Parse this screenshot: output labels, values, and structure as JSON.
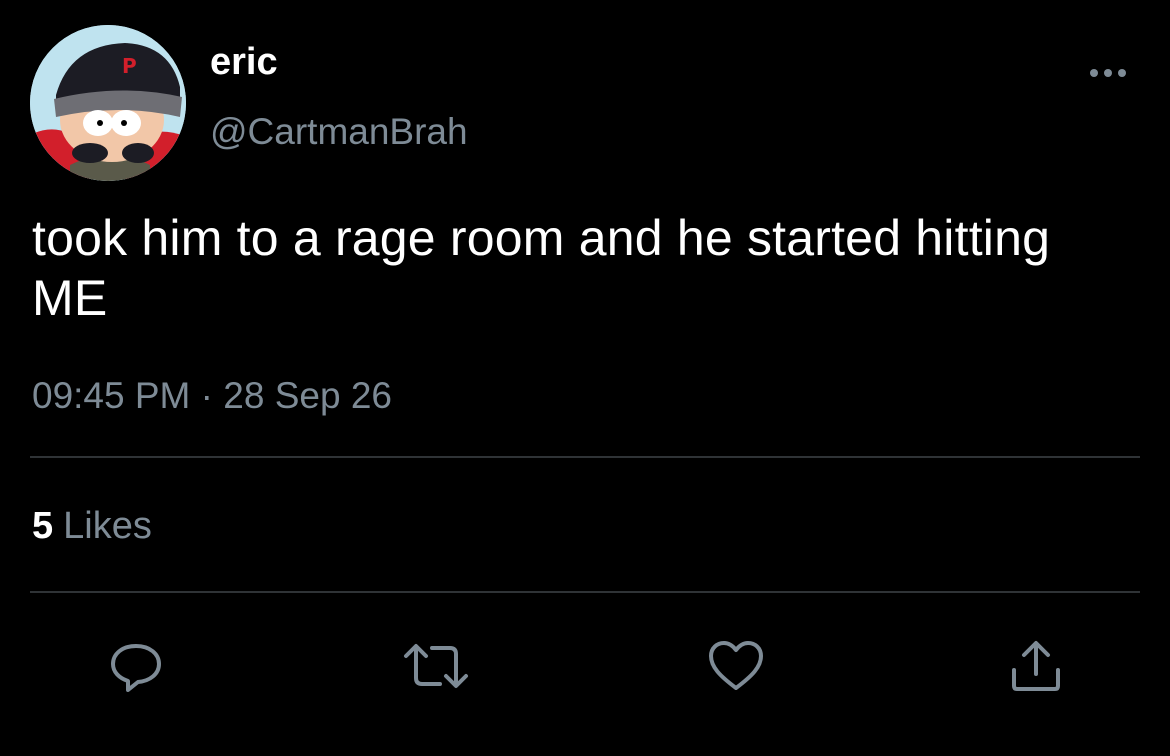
{
  "user": {
    "display_name": "eric",
    "handle": "@CartmanBrah",
    "avatar_icon": "cartman-avatar"
  },
  "tweet": {
    "text": "took him to a rage room and he started hitting ME",
    "time": "09:45 PM",
    "separator": "·",
    "date": "28 Sep 26"
  },
  "stats": {
    "likes_count": "5",
    "likes_label": "Likes"
  },
  "actions": [
    {
      "name": "reply",
      "icon": "reply-icon"
    },
    {
      "name": "retweet",
      "icon": "retweet-icon"
    },
    {
      "name": "like",
      "icon": "heart-icon"
    },
    {
      "name": "share",
      "icon": "share-icon"
    }
  ],
  "colors": {
    "background": "#000000",
    "text_primary": "#ffffff",
    "text_secondary": "#7e8b96",
    "divider": "#2f3336"
  }
}
